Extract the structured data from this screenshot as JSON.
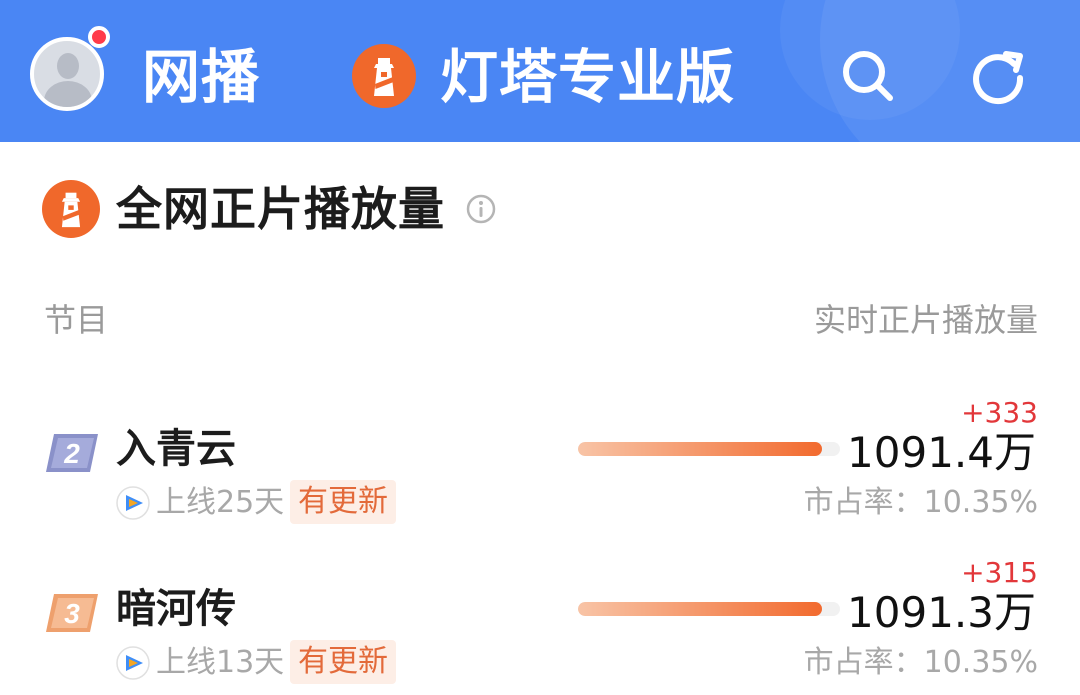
{
  "header": {
    "app_name": "网播",
    "brand_title": "灯塔专业版",
    "icons": {
      "brand": "lighthouse-logo-icon",
      "search": "search-icon",
      "refresh": "refresh-icon",
      "avatar": "user-avatar"
    },
    "colors": {
      "header_bg": "#4a86f4",
      "notification_dot": "#ff3b4a"
    }
  },
  "section": {
    "title": "全网正片播放量",
    "info_icon": "info-icon"
  },
  "columns": {
    "left": "节目",
    "right": "实时正片播放量"
  },
  "rows": [
    {
      "rank": "2",
      "name": "入青云",
      "platform_icon": "tencent-video-icon",
      "online_days": "上线25天",
      "update_badge": "有更新",
      "delta": "+333",
      "views": "1091.4万",
      "share": "市占率：10.35%",
      "bar_fraction": 0.93
    },
    {
      "rank": "3",
      "name": "暗河传",
      "platform_icon": "tencent-video-icon",
      "online_days": "上线13天",
      "update_badge": "有更新",
      "delta": "+315",
      "views": "1091.3万",
      "share": "市占率：10.35%",
      "bar_fraction": 0.93
    }
  ],
  "colors": {
    "bar_gradient_start": "#f8c4a6",
    "bar_gradient_end": "#f26a2e",
    "delta": "#e2373a",
    "badge_bg": "#fdeee6",
    "badge_text": "#e36a3a",
    "rank2_badge": "#8a91c9",
    "rank3_badge": "#f0a877"
  }
}
